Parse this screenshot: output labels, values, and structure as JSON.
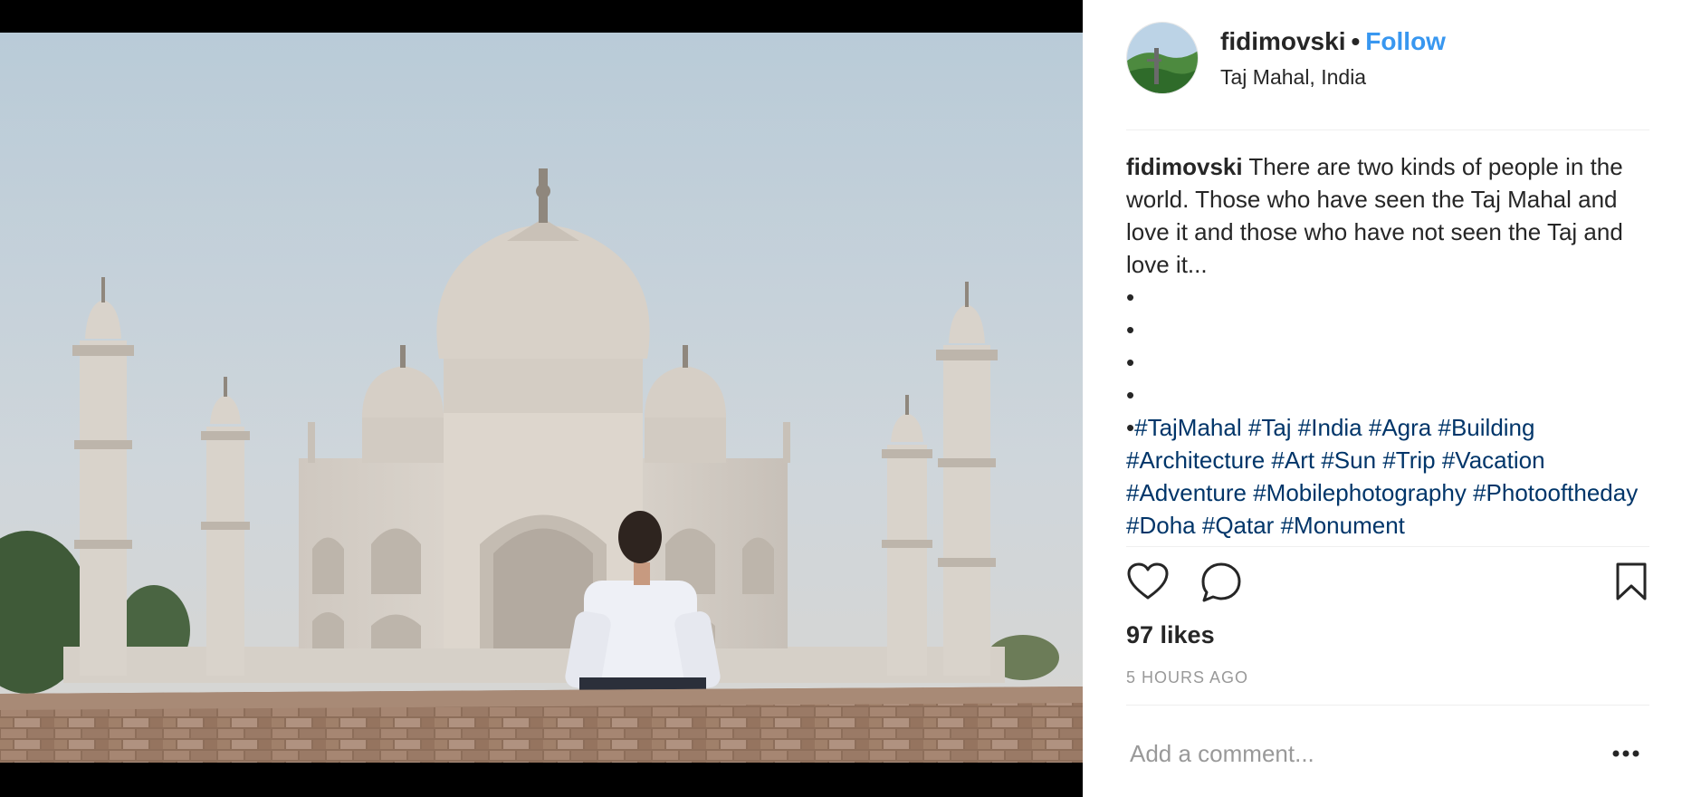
{
  "post": {
    "username": "fidimovski",
    "separator": "•",
    "follow_label": "Follow",
    "location": "Taj Mahal, India",
    "caption": {
      "username": "fidimovski",
      "text": "There are two kinds of people in the world. Those who have seen the Taj Mahal and love it and those who have not seen the Taj and love it...",
      "bullets": [
        "•",
        "•",
        "•",
        "•"
      ],
      "last_bullet": "•",
      "hashtags": [
        "#TajMahal",
        "#Taj",
        "#India",
        "#Agra",
        "#Building",
        "#Architecture",
        "#Art",
        "#Sun",
        "#Trip",
        "#Vacation",
        "#Adventure",
        "#Mobilephotography",
        "#Photooftheday",
        "#Doha",
        "#Qatar",
        "#Monument"
      ]
    },
    "likes": "97 likes",
    "timestamp": "5 HOURS AGO",
    "comment_placeholder": "Add a comment..."
  },
  "icons": {
    "like": "heart-icon",
    "comment": "comment-bubble-icon",
    "save": "bookmark-icon",
    "more": "more-options-icon"
  },
  "colors": {
    "follow": "#3897f0",
    "hashtag": "#003569",
    "muted": "#999999",
    "text": "#262626"
  }
}
